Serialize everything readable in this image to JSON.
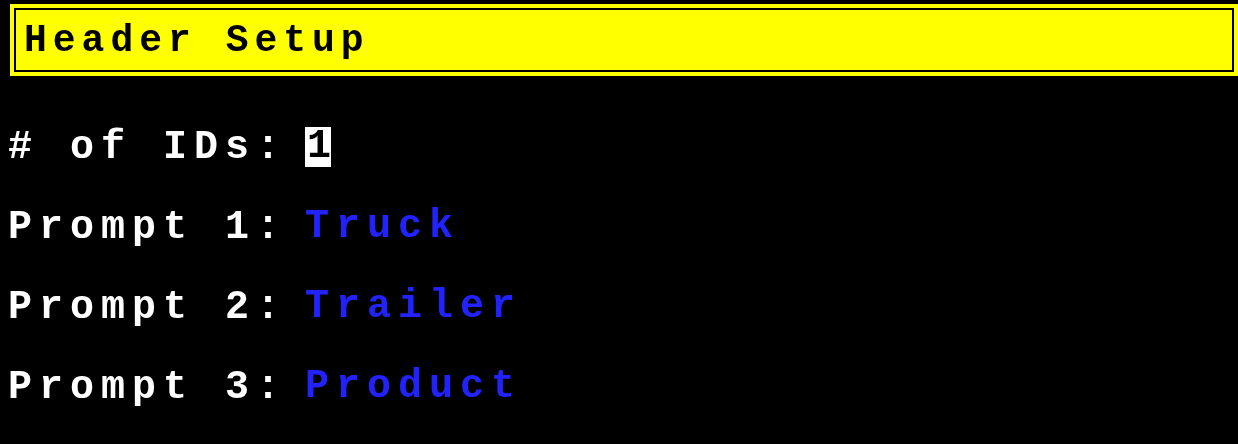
{
  "header": {
    "title": "Header Setup"
  },
  "id_count": {
    "label": "# of IDs:",
    "value": "1",
    "focused": true
  },
  "prompts": [
    {
      "label": "Prompt 1:",
      "value": "Truck"
    },
    {
      "label": "Prompt 2:",
      "value": "Trailer"
    },
    {
      "label": "Prompt 3:",
      "value": "Product"
    }
  ]
}
